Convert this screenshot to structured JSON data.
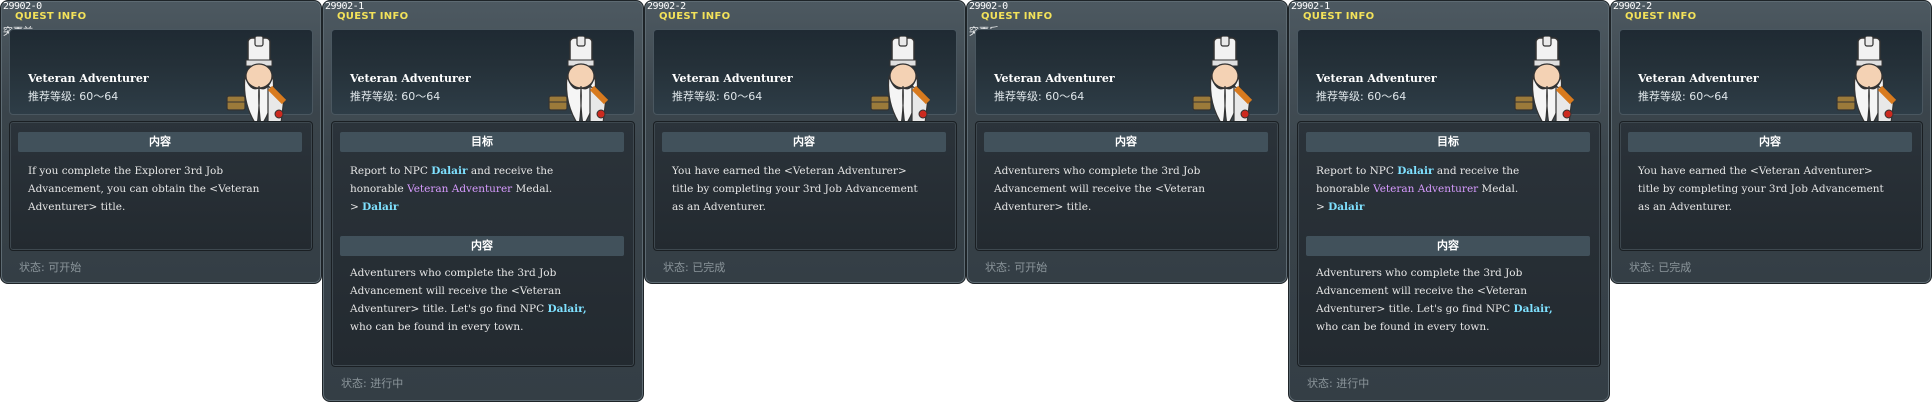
{
  "labels": {
    "quest_info": "QUEST INFO",
    "npc_name": "Dalair"
  },
  "cards": [
    {
      "id": "29902-0",
      "subtitle": "突更前",
      "name": "Veteran Adventurer",
      "level": "推荐等级: 60～64",
      "sections": [
        {
          "title": "内容",
          "lines": [
            "If you complete the Explorer 3rd Job",
            "Advancement, you can obtain the <Veteran",
            "Adventurer> title."
          ]
        }
      ],
      "status": "状态:  可开始"
    },
    {
      "id": "29902-1",
      "subtitle": "",
      "name": "Veteran Adventurer",
      "level": "推荐等级: 60～64",
      "sections": [
        {
          "title": "目标",
          "lines": [
            "Report to NPC ",
            "Dalair",
            " and receive the",
            "honorable ",
            "Veteran Adventurer",
            " Medal.",
            "> ",
            "Dalair"
          ]
        },
        {
          "title": "内容",
          "lines": [
            "Adventurers who complete the 3rd Job",
            "Advancement will receive the <Veteran",
            "Adventurer> title. Let's go find NPC ",
            "Dalair,",
            "who can be found in every town."
          ]
        }
      ],
      "status": "状态:  进行中"
    },
    {
      "id": "29902-2",
      "subtitle": "",
      "name": "Veteran Adventurer",
      "level": "推荐等级: 60～64",
      "sections": [
        {
          "title": "内容",
          "lines": [
            "You have earned the <Veteran Adventurer>",
            "title by completing your 3rd Job Advancement",
            "as an Adventurer."
          ]
        }
      ],
      "status": "状态:  已完成"
    },
    {
      "id": "29902-0",
      "subtitle": "突更后",
      "name": "Veteran Adventurer",
      "level": "推荐等级: 60～64",
      "sections": [
        {
          "title": "内容",
          "lines": [
            "Adventurers who complete the 3rd Job",
            "Advancement will receive the <Veteran",
            "Adventurer> title."
          ]
        }
      ],
      "status": "状态:  可开始"
    },
    {
      "id": "29902-1",
      "subtitle": "",
      "name": "Veteran Adventurer",
      "level": "推荐等级: 60～64",
      "sections": [
        {
          "title": "目标",
          "lines": [
            "Report to NPC ",
            "Dalair",
            " and receive the",
            "honorable ",
            "Veteran Adventurer",
            " Medal.",
            "> ",
            "Dalair"
          ]
        },
        {
          "title": "内容",
          "lines": [
            "Adventurers who complete the 3rd Job",
            "Advancement will receive the <Veteran",
            "Adventurer> title. Let's go find NPC ",
            "Dalair,",
            "who can be found in every town."
          ]
        }
      ],
      "status": "状态:  进行中"
    },
    {
      "id": "29902-2",
      "subtitle": "",
      "name": "Veteran Adventurer",
      "level": "推荐等级: 60～64",
      "sections": [
        {
          "title": "内容",
          "lines": [
            "You have earned the <Veteran Adventurer>",
            "title by completing your 3rd Job Advancement",
            "as an Adventurer."
          ]
        }
      ],
      "status": "状态:  已完成"
    }
  ]
}
